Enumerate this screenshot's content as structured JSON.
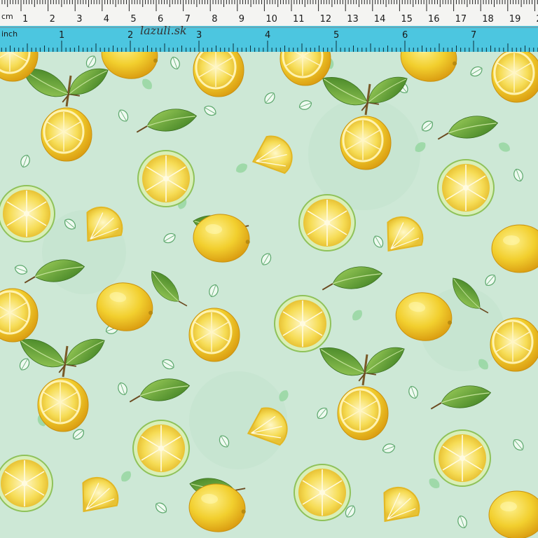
{
  "ruler": {
    "cm_unit": "cm",
    "inch_unit": "inch",
    "brand": "lazuli.sk",
    "cm_labels": [
      "1",
      "2",
      "3",
      "4",
      "5",
      "6",
      "7",
      "8",
      "9",
      "10",
      "11",
      "12",
      "13",
      "14",
      "15",
      "16",
      "17",
      "18",
      "19",
      "2"
    ],
    "inch_labels": [
      "1",
      "2",
      "3",
      "4",
      "5",
      "6",
      "7"
    ]
  },
  "colors": {
    "background": "#cde8d6",
    "lemon": "#f2cf2e",
    "lemon_dark": "#e0a812",
    "lemon_light": "#fbe97a",
    "leaf": "#5a9a2e",
    "leaf_light": "#9bd179",
    "ruler_top": "#f4f4f2",
    "ruler_bottom": "#4cc6e0"
  }
}
